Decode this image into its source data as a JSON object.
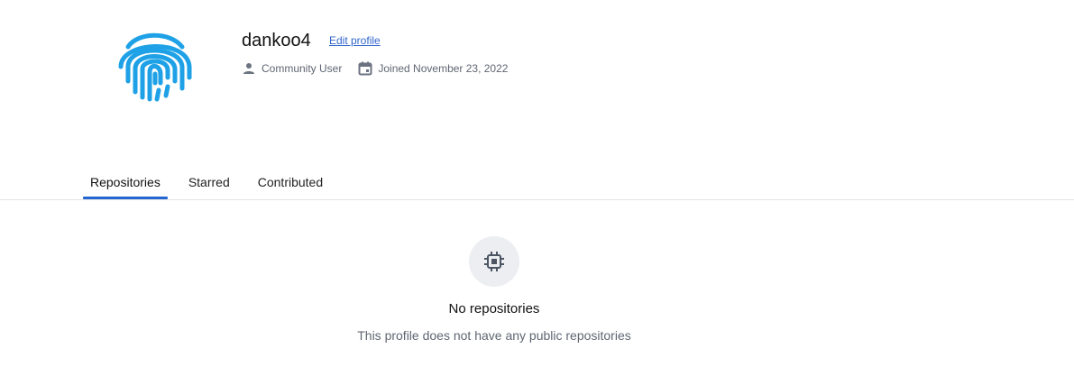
{
  "profile": {
    "username": "dankoo4",
    "edit_label": "Edit profile",
    "role": "Community User",
    "joined": "Joined November 23, 2022",
    "avatar_icon": "fingerprint-icon",
    "avatar_color": "#1ea1e6"
  },
  "tabs": [
    {
      "label": "Repositories",
      "active": true
    },
    {
      "label": "Starred",
      "active": false
    },
    {
      "label": "Contributed",
      "active": false
    }
  ],
  "empty_state": {
    "icon": "chip-icon",
    "title": "No repositories",
    "description": "This profile does not have any public repositories"
  },
  "colors": {
    "accent": "#2366d1",
    "link": "#3366cc",
    "muted_text": "#5f6672"
  }
}
